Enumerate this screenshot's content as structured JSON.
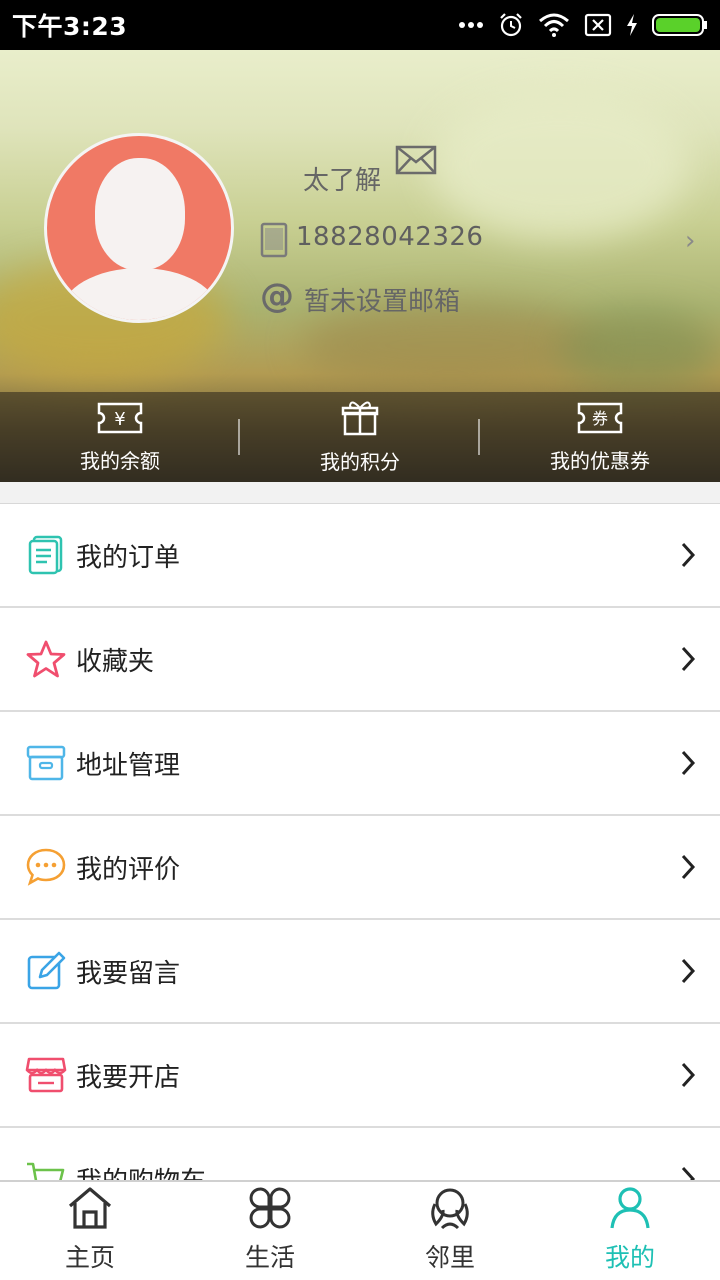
{
  "status_bar": {
    "time": "下午3:23"
  },
  "profile": {
    "username": "太了解",
    "phone": "18828042326",
    "email": "暂未设置邮箱"
  },
  "wallet": [
    {
      "label": "我的余额",
      "icon": "yen-ticket-icon"
    },
    {
      "label": "我的积分",
      "icon": "gift-icon"
    },
    {
      "label": "我的优惠券",
      "icon": "coupon-icon"
    }
  ],
  "menu": [
    {
      "label": "我的订单",
      "icon": "order-list-icon",
      "color": "#2ec3b0"
    },
    {
      "label": "收藏夹",
      "icon": "star-icon",
      "color": "#f04e6e"
    },
    {
      "label": "地址管理",
      "icon": "archive-box-icon",
      "color": "#4fb6e8"
    },
    {
      "label": "我的评价",
      "icon": "chat-bubble-icon",
      "color": "#f5a033"
    },
    {
      "label": "我要留言",
      "icon": "edit-note-icon",
      "color": "#3aa4e6"
    },
    {
      "label": "我要开店",
      "icon": "shop-icon",
      "color": "#f04e6e"
    },
    {
      "label": "我的购物车",
      "icon": "cart-icon",
      "color": "#6cc24a"
    }
  ],
  "bottom_nav": [
    {
      "label": "主页",
      "icon": "home-icon"
    },
    {
      "label": "生活",
      "icon": "clover-icon"
    },
    {
      "label": "邻里",
      "icon": "neighbor-icon"
    },
    {
      "label": "我的",
      "icon": "person-icon",
      "active": true
    }
  ],
  "colors": {
    "accent": "#1ec0b4",
    "avatar_bg": "#f07965"
  }
}
